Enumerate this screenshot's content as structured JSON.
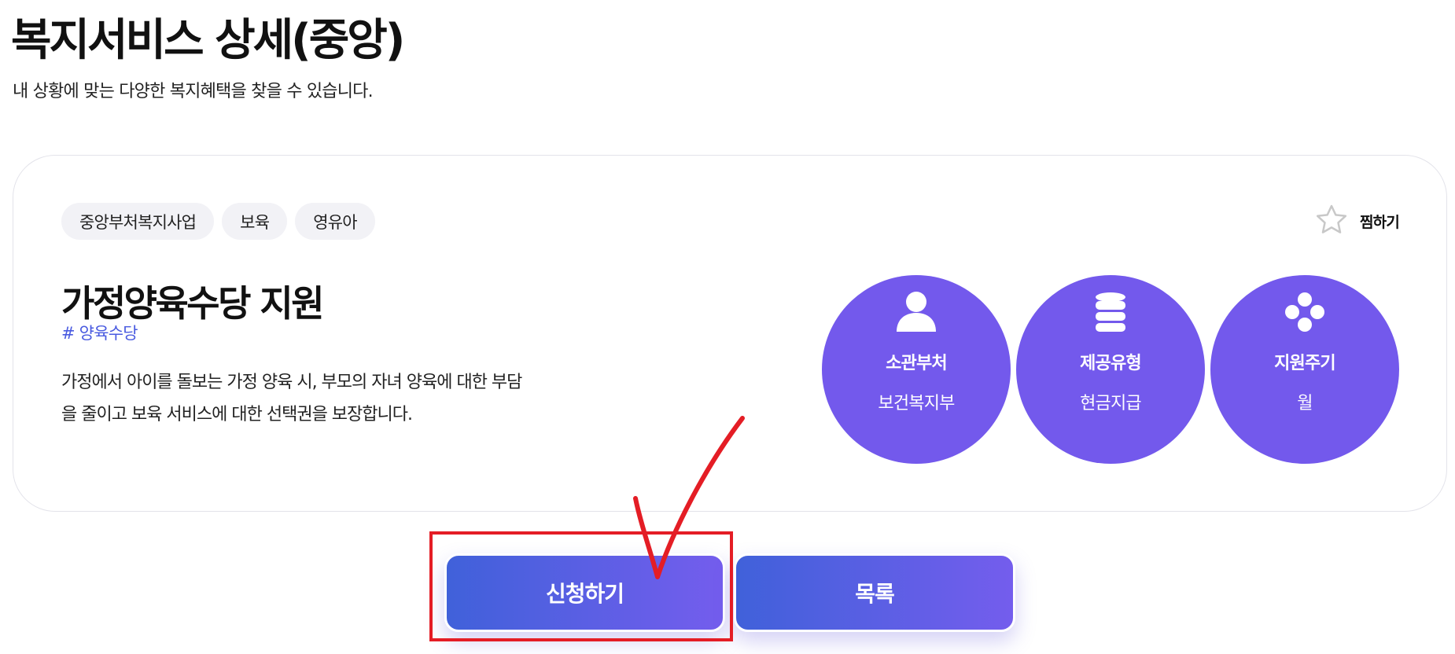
{
  "header": {
    "title": "복지서비스 상세(중앙)",
    "subtitle": "내 상황에 맞는 다양한 복지혜택을 찾을 수 있습니다."
  },
  "service": {
    "tags": [
      "중앙부처복지사업",
      "보육",
      "영유아"
    ],
    "favorite_label": "찜하기",
    "name": "가정양육수당 지원",
    "hashtag": "# 양육수당",
    "description": "가정에서 아이를 돌보는 가정 양육 시, 부모의 자녀 양육에 대한 부담을 줄이고 보육 서비스에 대한 선택권을 보장합니다.",
    "info": [
      {
        "icon": "person-icon",
        "title": "소관부처",
        "value": "보건복지부"
      },
      {
        "icon": "coin-stack-icon",
        "title": "제공유형",
        "value": "현금지급"
      },
      {
        "icon": "cycle-dots-icon",
        "title": "지원주기",
        "value": "월"
      }
    ]
  },
  "actions": {
    "apply_label": "신청하기",
    "list_label": "목록"
  },
  "colors": {
    "accent": "#7359ec",
    "button_gradient_start": "#4061da",
    "button_gradient_end": "#745ded",
    "hashtag": "#4a5be0",
    "annotation_red": "#e41d25"
  }
}
